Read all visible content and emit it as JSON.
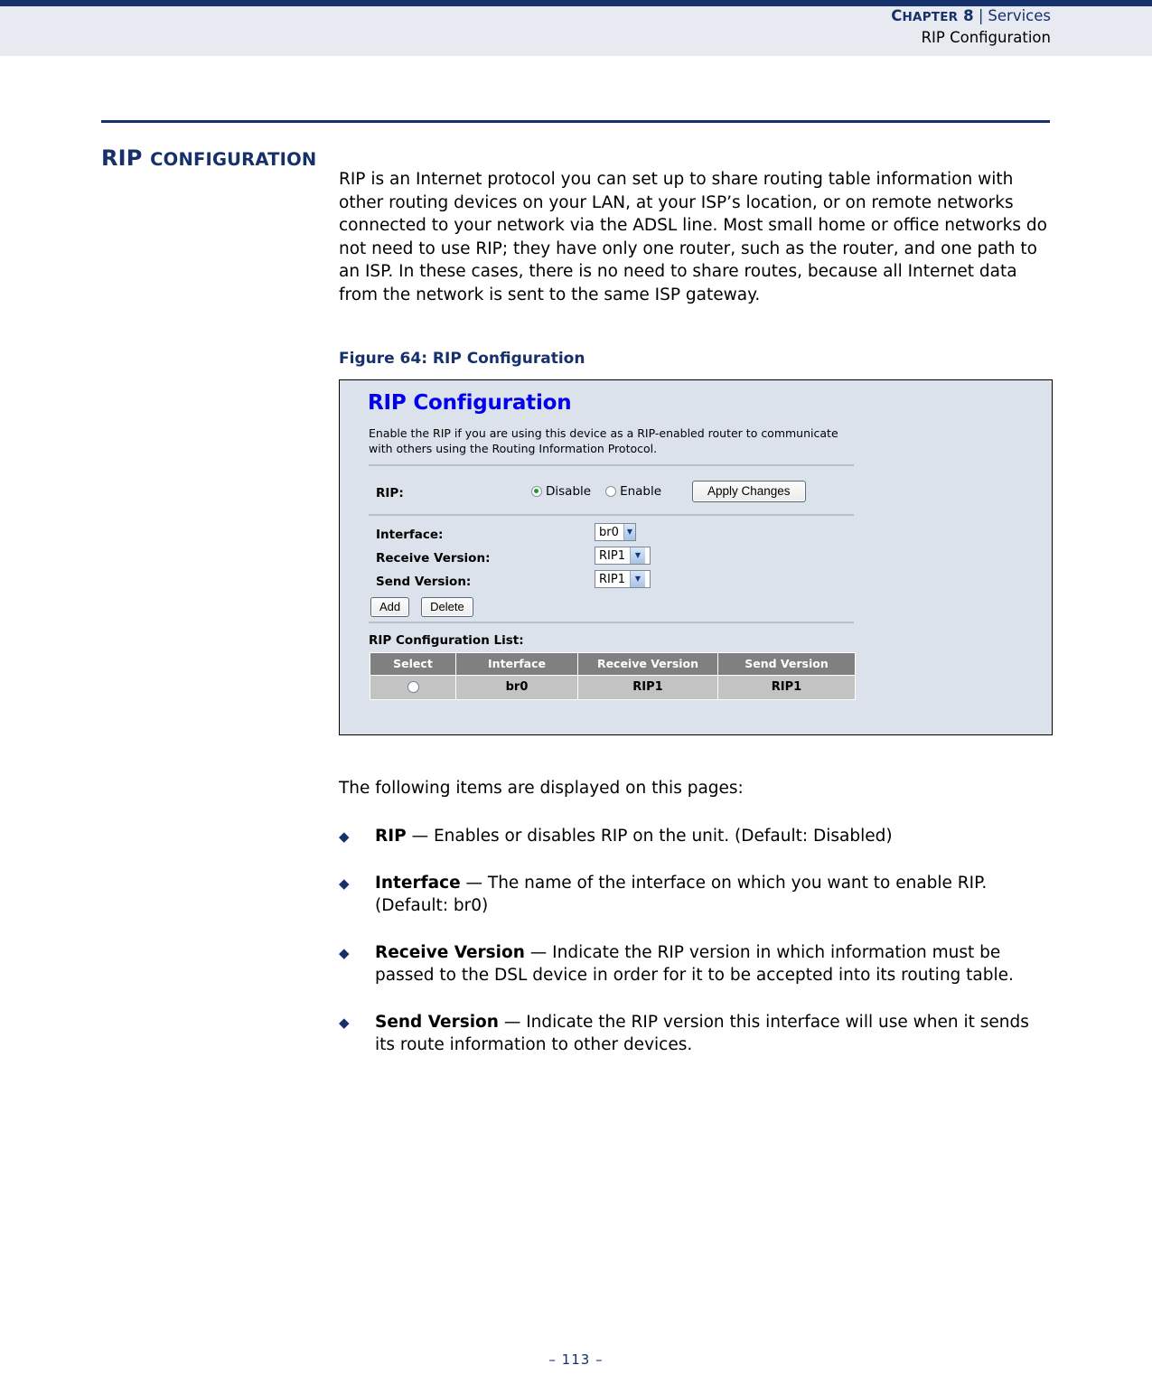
{
  "header": {
    "chapter_label": "CHAPTER 8",
    "chapter_word": "C",
    "chapter_rest": "HAPTER",
    "chapter_number": "8",
    "separator": "|",
    "section": "Services",
    "subsection": "RIP Configuration"
  },
  "section": {
    "title_first": "RIP",
    "title_cap": "C",
    "title_rest": "ONFIGURATION",
    "title_full": "RIP CONFIGURATION"
  },
  "intro_paragraph": "RIP is an Internet protocol you can set up to share routing table information with other routing devices on your LAN, at your ISP’s location, or on remote networks connected to your network via the ADSL line. Most small home or office networks do not need to use RIP; they have only one router, such as the router, and one path to an ISP. In these cases, there is no need to share routes, because all Internet data from the network is sent to the same ISP gateway.",
  "figure": {
    "caption": "Figure 64:  RIP Configuration",
    "ui": {
      "title": "RIP Configuration",
      "description": "Enable the RIP if you are using this device as a RIP-enabled router to communicate with others using the Routing Information Protocol.",
      "rip_label": "RIP:",
      "radio_disable": "Disable",
      "radio_enable": "Enable",
      "radio_selected": "Disable",
      "apply_button": "Apply Changes",
      "fields": [
        {
          "label": "Interface:",
          "value": "br0"
        },
        {
          "label": "Receive Version:",
          "value": "RIP1"
        },
        {
          "label": "Send Version:",
          "value": "RIP1"
        }
      ],
      "add_button": "Add",
      "delete_button": "Delete",
      "list_title": "RIP Configuration List:",
      "table": {
        "columns": [
          "Select",
          "Interface",
          "Receive Version",
          "Send Version"
        ],
        "rows": [
          {
            "select": "",
            "interface": "br0",
            "receive_version": "RIP1",
            "send_version": "RIP1"
          }
        ]
      },
      "colors": {
        "panel_background": "#dbe2ec",
        "title_blue": "#0000ee",
        "table_header_gray": "#808080",
        "table_row_gray": "#c3c3c3",
        "radio_selected_green": "#14a01e"
      }
    }
  },
  "lead_text": "The following items are displayed on this pages:",
  "bullets": [
    {
      "glyph": "◆",
      "term": "RIP",
      "dash": " — ",
      "text": "Enables or disables RIP on the unit. (Default: Disabled)"
    },
    {
      "glyph": "◆",
      "term": "Interface",
      "dash": " — ",
      "text": "The name of the interface on which you want to enable RIP. (Default: br0)"
    },
    {
      "glyph": "◆",
      "term": "Receive Version",
      "dash": " — ",
      "text": "Indicate the RIP version in which information must be passed to the DSL device in order for it to be accepted into its routing table."
    },
    {
      "glyph": "◆",
      "term": "Send Version",
      "dash": " — ",
      "text": "Indicate the RIP version this interface will use when it sends its route information to other devices."
    }
  ],
  "footer": {
    "page_number": "–  113  –"
  },
  "theme": {
    "navy": "#16306b",
    "header_band": "#e7eaf1"
  }
}
